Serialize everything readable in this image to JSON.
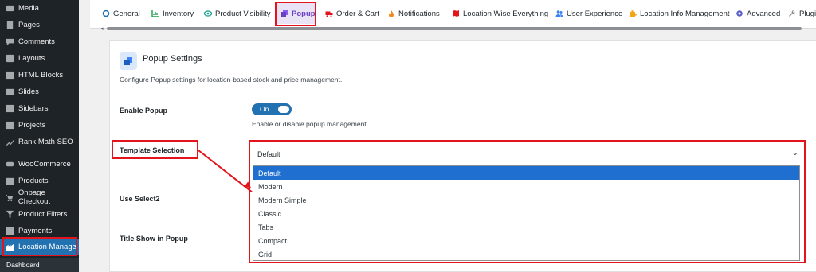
{
  "sidebar": {
    "items": [
      {
        "label": "Media",
        "icon": "media-icon"
      },
      {
        "label": "Pages",
        "icon": "pages-icon"
      },
      {
        "label": "Comments",
        "icon": "comments-icon"
      },
      {
        "label": "Layouts",
        "icon": "layouts-icon"
      },
      {
        "label": "HTML Blocks",
        "icon": "html-blocks-icon"
      },
      {
        "label": "Slides",
        "icon": "slides-icon"
      },
      {
        "label": "Sidebars",
        "icon": "sidebars-icon"
      },
      {
        "label": "Projects",
        "icon": "projects-icon"
      },
      {
        "label": "Rank Math SEO",
        "icon": "rank-math-icon"
      },
      {
        "label": "WooCommerce",
        "icon": "woocommerce-icon"
      },
      {
        "label": "Products",
        "icon": "products-icon"
      },
      {
        "label": "Onpage Checkout",
        "icon": "checkout-icon"
      },
      {
        "label": "Product Filters",
        "icon": "filter-icon"
      },
      {
        "label": "Payments",
        "icon": "payments-icon"
      },
      {
        "label": "Location Manage",
        "icon": "location-manage-icon"
      }
    ],
    "submenu_label": "Dashboard"
  },
  "tabs": [
    {
      "label": "General",
      "icon": "gear-icon"
    },
    {
      "label": "Inventory",
      "icon": "chart-icon"
    },
    {
      "label": "Product Visibility",
      "icon": "eye-icon"
    },
    {
      "label": "Popup",
      "icon": "popup-icon"
    },
    {
      "label": "Order & Cart",
      "icon": "truck-icon"
    },
    {
      "label": "Notifications",
      "icon": "flame-icon"
    },
    {
      "label": "Location Wise Everything",
      "icon": "map-icon"
    },
    {
      "label": "User Experience",
      "icon": "users-icon"
    },
    {
      "label": "Location Info Management",
      "icon": "puzzle-icon"
    },
    {
      "label": "Advanced",
      "icon": "cog-icon"
    },
    {
      "label": "Plugi",
      "icon": "wrench-icon"
    }
  ],
  "card": {
    "title": "Popup Settings",
    "description": "Configure Popup settings for location-based stock and price management."
  },
  "fields": {
    "enable_popup_label": "Enable Popup",
    "enable_popup_state": "On",
    "enable_popup_help": "Enable or disable popup management.",
    "template_label": "Template Selection",
    "template_value": "Default",
    "use_select2_label": "Use Select2",
    "title_show_label": "Title Show in Popup"
  },
  "template_options": [
    "Default",
    "Modern",
    "Modern Simple",
    "Classic",
    "Tabs",
    "Compact",
    "Grid"
  ],
  "colors": {
    "sidebar_bg": "#1d2327",
    "accent": "#2271b1",
    "active_tab": "#6b3fc4",
    "annotation": "#e3141b",
    "selected_option": "#1e6fd0"
  }
}
